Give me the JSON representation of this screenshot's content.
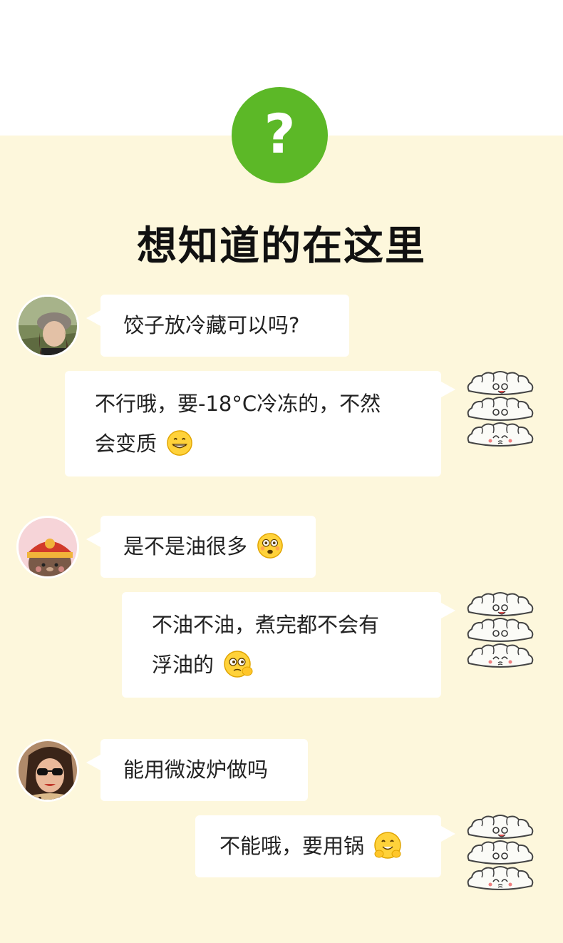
{
  "header": {
    "icon": "question-mark-icon",
    "icon_glyph": "?",
    "accent_color": "#5cb827",
    "title": "想知道的在这里"
  },
  "chat": [
    {
      "question": {
        "avatar": "avatar-woman-beret",
        "text": "饺子放冷藏可以吗?"
      },
      "answer": {
        "avatar": "dumpling-stack-icon",
        "text_line1": "不行哦，要-18°C冷冻的，不然",
        "text_line2": "会变质",
        "emoji": "grinning-face-icon"
      }
    },
    {
      "question": {
        "avatar": "avatar-bear-hat",
        "text": "是不是油很多",
        "emoji": "flushed-face-icon"
      },
      "answer": {
        "avatar": "dumpling-stack-icon",
        "text_line1": "不油不油，煮完都不会有",
        "text_line2": "浮油的",
        "emoji": "face-with-monocle-icon"
      }
    },
    {
      "question": {
        "avatar": "avatar-woman-sunglasses",
        "text": "能用微波炉做吗"
      },
      "answer": {
        "avatar": "dumpling-stack-icon",
        "text_line1": "不能哦，要用锅",
        "emoji": "hugging-face-icon"
      }
    }
  ],
  "colors": {
    "background_cream": "#fdf7dc",
    "bubble": "#ffffff",
    "text": "#222222"
  }
}
